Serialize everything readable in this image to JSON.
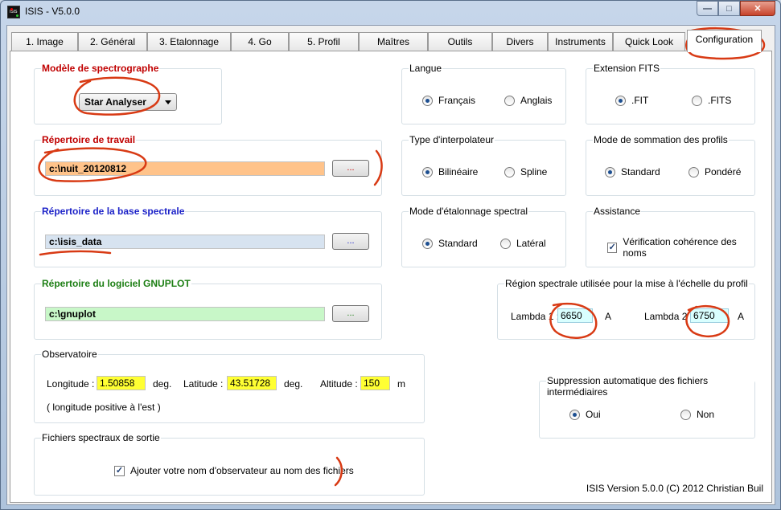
{
  "window": {
    "title": "ISIS - V5.0.0",
    "icon_name": "isis-app-icon"
  },
  "title_controls": [
    "minimize-icon",
    "maximize-icon",
    "close-icon"
  ],
  "tabs": [
    {
      "label": "1. Image"
    },
    {
      "label": "2. Général"
    },
    {
      "label": "3. Etalonnage"
    },
    {
      "label": "4. Go"
    },
    {
      "label": "5. Profil"
    },
    {
      "label": "Maîtres"
    },
    {
      "label": "Outils"
    },
    {
      "label": "Divers"
    },
    {
      "label": "Instruments"
    },
    {
      "label": "Quick Look"
    },
    {
      "label": "Configuration"
    }
  ],
  "active_tab": "Configuration",
  "spectrograph": {
    "title": "Modèle de spectrographe",
    "selected": "Star Analyser"
  },
  "work_dir": {
    "title": "Répertoire de travail",
    "value": "c:\\nuit_20120812",
    "button": "...",
    "bg": "#ffc38a"
  },
  "spectral_base_dir": {
    "title": "Répertoire de la base spectrale",
    "value": "c:\\isis_data",
    "button": "...",
    "bg": "#d7e3f0"
  },
  "gnuplot_dir": {
    "title": "Répertoire du logiciel GNUPLOT",
    "value": "c:\\gnuplot",
    "button": "...",
    "bg": "#c8f7c8"
  },
  "language": {
    "title": "Langue",
    "options": [
      "Français",
      "Anglais"
    ],
    "selected": "Français"
  },
  "fits_ext": {
    "title": "Extension FITS",
    "options": [
      ".FIT",
      ".FITS"
    ],
    "selected": ".FIT"
  },
  "interpolator": {
    "title": "Type d'interpolateur",
    "options": [
      "Bilinéaire",
      "Spline"
    ],
    "selected": "Bilinéaire"
  },
  "profile_sum": {
    "title": "Mode de sommation des profils",
    "options": [
      "Standard",
      "Pondéré"
    ],
    "selected": "Standard"
  },
  "calibration_mode": {
    "title": "Mode d'étalonnage spectral",
    "options": [
      "Standard",
      "Latéral"
    ],
    "selected": "Standard"
  },
  "assistance": {
    "title": "Assistance",
    "check_label": "Vérification cohérence des noms",
    "checked": true
  },
  "spectral_region": {
    "title": "Région spectrale utilisée pour la mise à l'échelle du profil",
    "lambda1_label": "Lambda 1 :",
    "lambda1": "6650",
    "lambda2_label": "Lambda 2 :",
    "lambda2": "6750",
    "unit": "A"
  },
  "observatory": {
    "title": "Observatoire",
    "longitude_label": "Longitude :",
    "longitude": "1.50858",
    "longitude_unit": "deg.",
    "latitude_label": "Latitude :",
    "latitude": "43.51728",
    "latitude_unit": "deg.",
    "altitude_label": "Altitude :",
    "altitude": "150",
    "altitude_unit": "m",
    "note": "( longitude positive à l'est )"
  },
  "auto_delete": {
    "title": "Suppression automatique des fichiers intermédiaires",
    "options": [
      "Oui",
      "Non"
    ],
    "selected": "Oui"
  },
  "output_files": {
    "title": "Fichiers spectraux de sortie",
    "check_label": "Ajouter votre nom d'observateur au nom des fichiers",
    "checked": true
  },
  "footer": "ISIS Version 5.0.0 (C) 2012 Christian Buil",
  "colors": {
    "highlight_yellow": "#ffff33",
    "lambda_cyan": "#d9ffff",
    "annotation_red": "#d83a14"
  }
}
